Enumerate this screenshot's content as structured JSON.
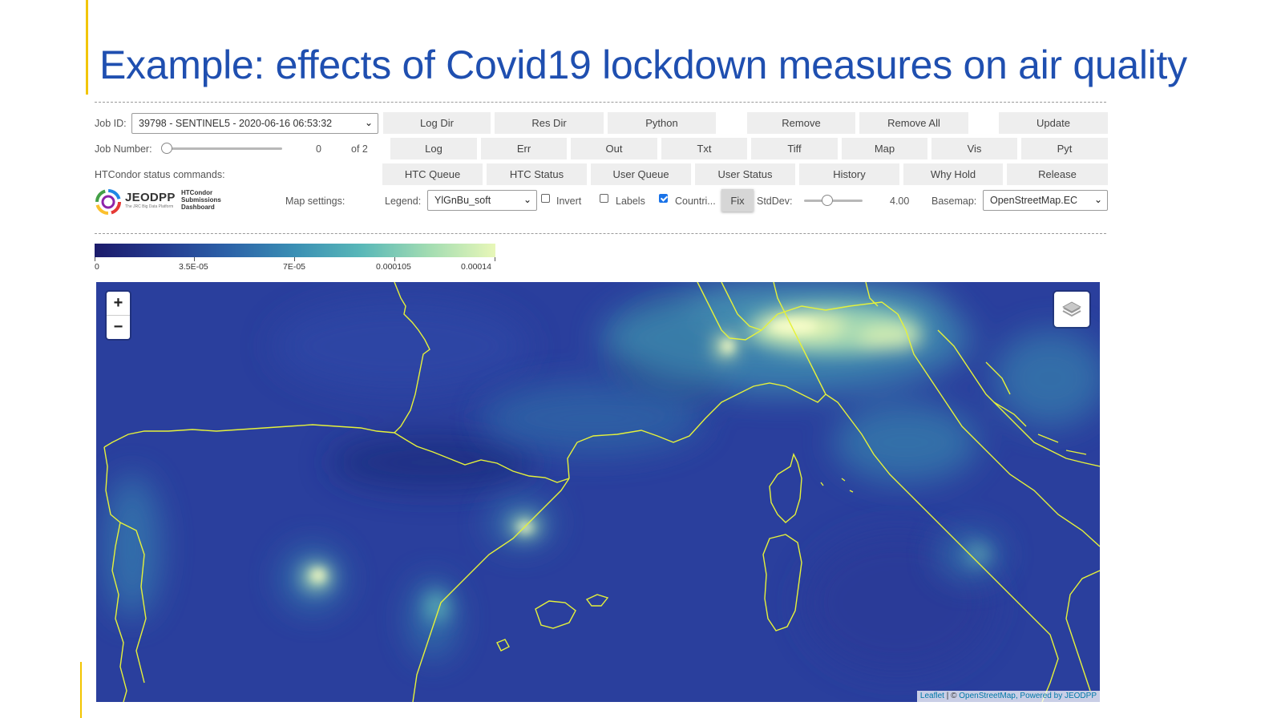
{
  "slide": {
    "title": "Example: effects of Covid19 lockdown measures on air quality"
  },
  "dashboard": {
    "job_id_label": "Job ID:",
    "job_id_value": "39798 - SENTINEL5 - 2020-06-16 06:53:32",
    "job_number_label": "Job Number:",
    "job_number_value": "0",
    "job_number_of": "of 2",
    "job_number_slider_fraction": 0,
    "htcondor_label": "HTCondor status commands:",
    "map_settings_label": "Map settings:",
    "buttons_row1": [
      "Log Dir",
      "Res Dir",
      "Python",
      "Remove",
      "Remove All",
      "Update"
    ],
    "buttons_row2": [
      "Log",
      "Err",
      "Out",
      "Txt",
      "Tiff",
      "Map",
      "Vis",
      "Pyt"
    ],
    "buttons_row3": [
      "HTC Queue",
      "HTC Status",
      "User Queue",
      "User Status",
      "History",
      "Why Hold",
      "Release"
    ],
    "legend_label": "Legend:",
    "legend_value": "YlGnBu_soft",
    "invert_label": "Invert",
    "invert_checked": false,
    "labels_label": "Labels",
    "labels_checked": false,
    "countries_label": "Countri...",
    "countries_checked": true,
    "fix_label": "Fix",
    "stddev_label": "StdDev:",
    "stddev_value": "4.00",
    "stddev_slider_fraction": 0.4,
    "basemap_label": "Basemap:",
    "basemap_value": "OpenStreetMap.EC"
  },
  "logo": {
    "name": "JEODPP",
    "tagline": "The JRC Big Data Platform",
    "app_line1": "HTCondor",
    "app_line2": "Submissions",
    "app_line3": "Dashboard"
  },
  "colorbar": {
    "ticks": [
      "0",
      "3.5E-05",
      "7E-05",
      "0.000105",
      "0.00014"
    ],
    "palette": [
      "#1b1b6a",
      "#243a8f",
      "#2c62a8",
      "#3a8fb4",
      "#59b8b8",
      "#a2dcb2",
      "#e8f7b8"
    ]
  },
  "map": {
    "zoom_in": "+",
    "zoom_out": "−",
    "attribution_leaflet": "Leaflet",
    "attribution_sep": " | © ",
    "attribution_osm": "OpenStreetMap",
    "attribution_powered": ", Powered by JEODPP",
    "border_color": "#e6f23a"
  }
}
